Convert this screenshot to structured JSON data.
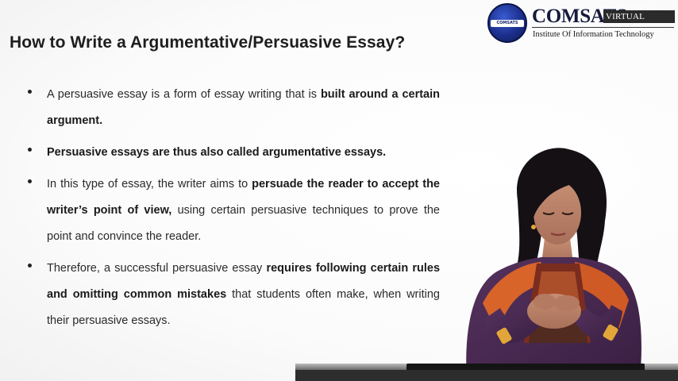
{
  "slide": {
    "title": "How to Write a Argumentative/Persuasive Essay?"
  },
  "logo": {
    "name": "COMSATS",
    "badge": "VIRTUAL CAMPUS",
    "subtitle": "Institute Of Information Technology",
    "seal_text": "COMSATS"
  },
  "bullets": [
    [
      {
        "t": "A persuasive essay is a form of essay writing that is ",
        "b": false
      },
      {
        "t": "built around a certain argument.",
        "b": true
      }
    ],
    [
      {
        "t": "Persuasive essays are thus also called argumentative essays.",
        "b": true
      }
    ],
    [
      {
        "t": "In this type of essay, the writer aims to ",
        "b": false
      },
      {
        "t": "persuade the reader to accept the writer’s point of view,",
        "b": true
      },
      {
        "t": " using certain persuasive techniques to prove the point and convince the reader.",
        "b": false
      }
    ],
    [
      {
        "t": "Therefore, a successful persuasive essay ",
        "b": false
      },
      {
        "t": "requires following certain rules and omitting common mistakes",
        "b": true
      },
      {
        "t": " that students often make, when writing their persuasive essays.",
        "b": false
      }
    ]
  ],
  "colors": {
    "title": "#1e1e1e",
    "body_text": "#2a2a2a",
    "logo_navy": "#1b2f8c",
    "kameez_purple": "#4a2a52",
    "dupatta_orange": "#d8642a"
  }
}
